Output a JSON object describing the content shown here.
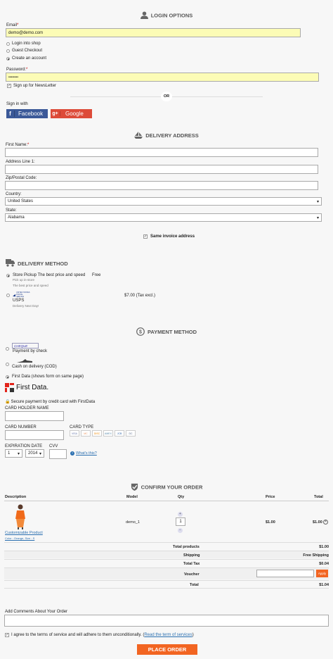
{
  "login": {
    "title": "LOGIN OPTIONS",
    "email_label": "Email",
    "email_value": "demo@demo.com",
    "opt_login": "Login into shop",
    "opt_guest": "Guest Checkout",
    "opt_create": "Create an account",
    "password_label": "Password:",
    "password_value": "••••••••",
    "newsletter_label": "Sign up for NewsLetter",
    "or_label": "OR",
    "signin_label": "Sign in with",
    "facebook_label": "Facebook",
    "google_label": "Google"
  },
  "delivery_address": {
    "title": "DELIVERY ADDRESS",
    "first_name_label": "First Name:",
    "address_label": "Address Line 1:",
    "zip_label": "Zip/Postal Code:",
    "country_label": "Country:",
    "country_value": "United States",
    "state_label": "State:",
    "state_value": "Alabama",
    "same_invoice_label": "Same invoice address"
  },
  "delivery_method": {
    "title": "DELIVERY METHOD",
    "store_pickup_label": "Store Pickup The best price and speed",
    "store_pickup_price": "Free",
    "store_pickup_sub1": "Pick up in-store",
    "store_pickup_sub2": "The best price and speed",
    "usps_logo": "UNITED STATES POSTAL SERVICE",
    "usps_label": "USPS",
    "usps_sub": "Delivery Next Day!",
    "usps_price": "$7.00 (Tax excl.)"
  },
  "payment": {
    "title": "PAYMENT METHOD",
    "cheque_logo": "CHEQUE",
    "cheque_label": "Payment by check",
    "cod_label": "Cash on delivery (COD)",
    "firstdata_label": "First Data (shows form on same page)",
    "firstdata_logo": "First Data.",
    "secure_label": "Secure payment by credit card with FirstData",
    "holder_label": "CARD HOLDER NAME",
    "number_label": "CARD NUMBER",
    "type_label": "CARD TYPE",
    "card_types": [
      "VISA",
      "MC",
      "DISC",
      "AMEX",
      "JCB",
      "DC"
    ],
    "exp_label": "EXPIRATION DATE",
    "exp_month": "1",
    "exp_year": "2014",
    "cvv_label": "CVV",
    "whats_this": "What's this?"
  },
  "order": {
    "title": "CONFIRM YOUR ORDER",
    "headers": {
      "description": "Description",
      "model": "Model",
      "qty": "Qty",
      "price": "Price",
      "total": "Total"
    },
    "product_name": "Customizable Product",
    "product_attrs": "Color : Orange, Size : S",
    "model": "demo_1",
    "qty": "1",
    "price": "$1.00",
    "total": "$1.00",
    "total_products_label": "Total products",
    "total_products": "$1.00",
    "shipping_label": "Shipping",
    "shipping": "Free Shipping",
    "tax_label": "Total Tax",
    "tax": "$0.04",
    "voucher_label": "Voucher",
    "apply_label": "Apply",
    "total_label": "Total",
    "grand_total": "$1.04",
    "comments_label": "Add Comments About Your Order",
    "terms_text": "I agree to the terms of service and will adhere to them unconditionally. (",
    "terms_link": "Read the term of services",
    "terms_close": ")",
    "place_order": "PLACE ORDER"
  },
  "colors": {
    "facebook": "#3b5998",
    "google": "#dd4b39",
    "place_order": "#f26522",
    "apply": "#f26522",
    "highlight": "#fcfcb6",
    "link": "#2a6fb0"
  }
}
